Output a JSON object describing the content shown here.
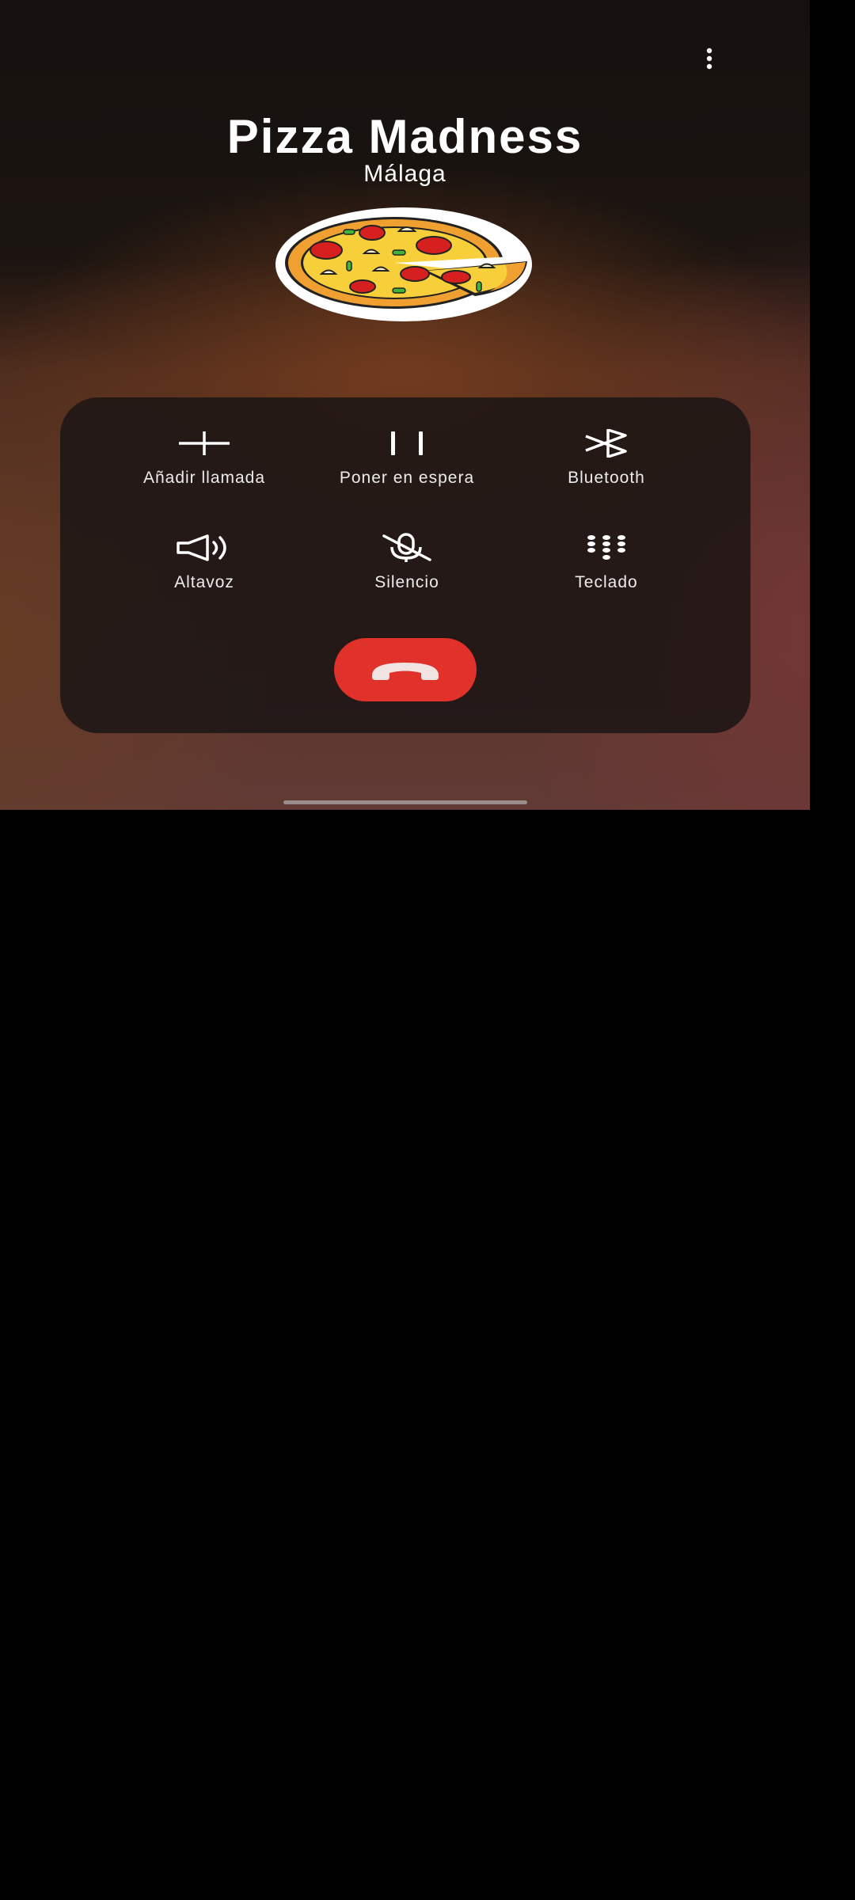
{
  "header": {
    "menu_icon": "more-vertical-icon"
  },
  "caller": {
    "name": "Pizza Madness",
    "location": "Málaga",
    "avatar_icon": "pizza-icon"
  },
  "controls": [
    {
      "label": "Añadir llamada",
      "icon": "add-call-icon"
    },
    {
      "label": "Poner en espera",
      "icon": "pause-icon"
    },
    {
      "label": "Bluetooth",
      "icon": "bluetooth-icon"
    },
    {
      "label": "Altavoz",
      "icon": "speaker-icon"
    },
    {
      "label": "Silencio",
      "icon": "mute-icon"
    },
    {
      "label": "Teclado",
      "icon": "keypad-icon"
    }
  ],
  "end_call": {
    "icon": "hang-up-icon",
    "color": "#e0322a"
  },
  "colors": {
    "panel": "#1c1614",
    "text": "#ffffff"
  }
}
